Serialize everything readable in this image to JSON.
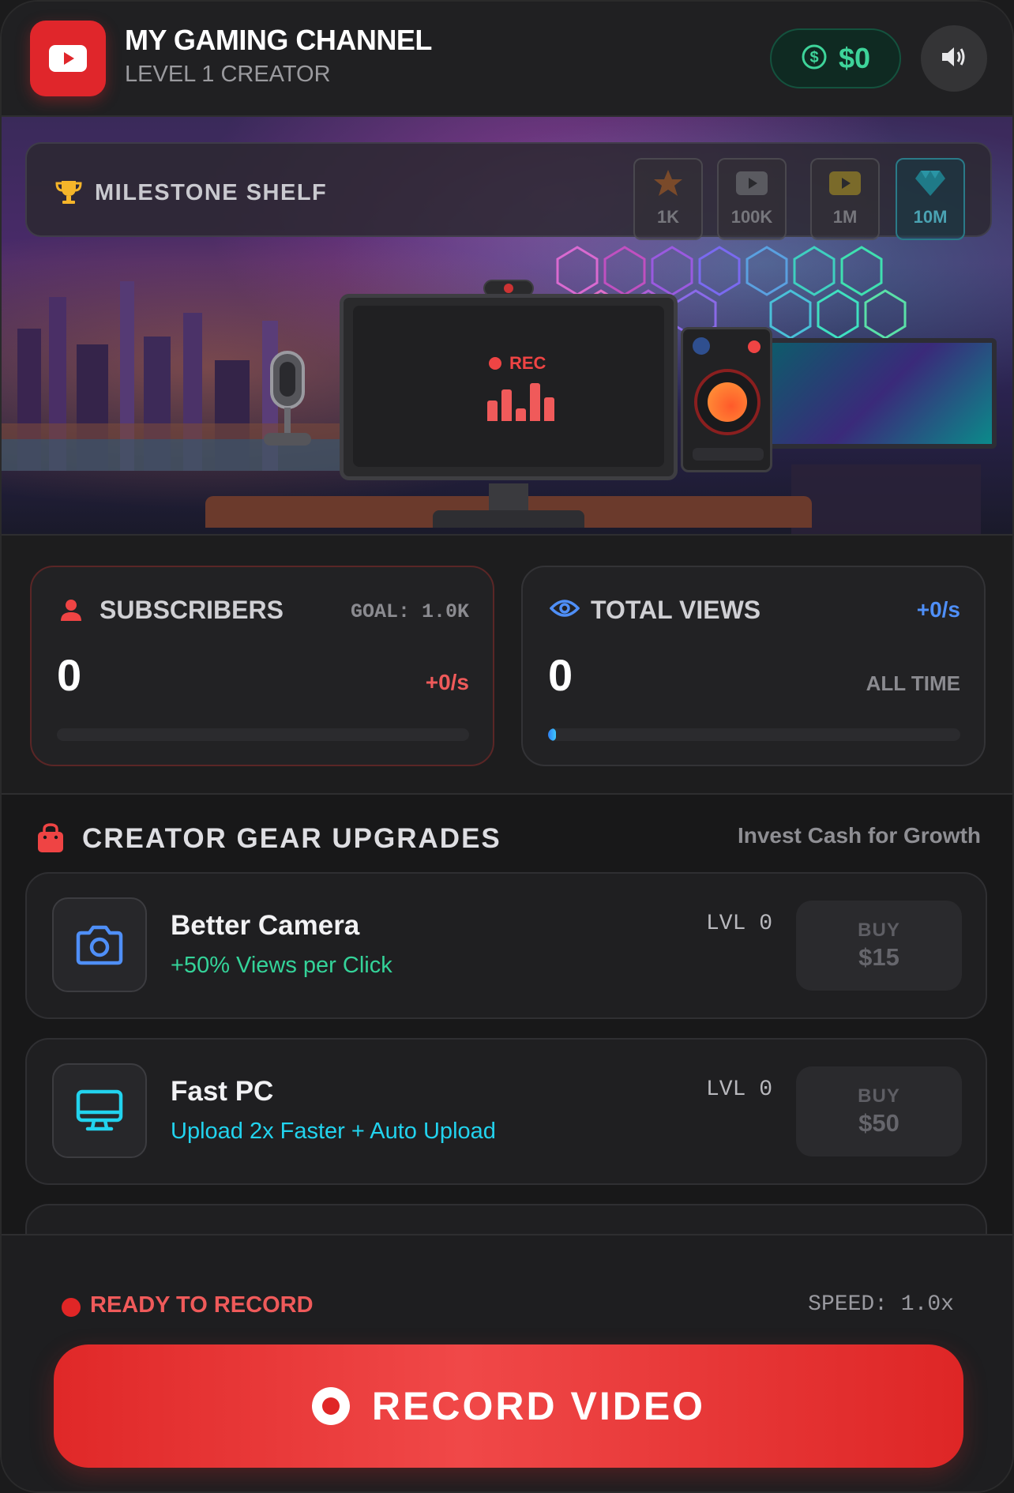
{
  "header": {
    "channel_title": "MY GAMING CHANNEL",
    "level": "LEVEL 1 CREATOR",
    "cash": "$0"
  },
  "milestones": {
    "title": "MILESTONE SHELF",
    "badges": [
      {
        "label": "1K",
        "icon": "star-icon"
      },
      {
        "label": "100K",
        "icon": "play-plaque-silver-icon"
      },
      {
        "label": "1M",
        "icon": "play-plaque-gold-icon"
      },
      {
        "label": "10M",
        "icon": "diamond-icon"
      }
    ]
  },
  "studio": {
    "rec_label": "REC"
  },
  "stats": {
    "subscribers": {
      "title": "SUBSCRIBERS",
      "goal": "GOAL: 1.0K",
      "value": "0",
      "rate": "+0/s",
      "progress": 0
    },
    "views": {
      "title": "TOTAL VIEWS",
      "rate": "+0/s",
      "value": "0",
      "note": "ALL TIME",
      "progress": 0.02
    }
  },
  "upgrades": {
    "title": "CREATOR GEAR UPGRADES",
    "subtitle": "Invest Cash for Growth",
    "items": [
      {
        "name": "Better Camera",
        "desc": "+50% Views per Click",
        "level": "LVL 0",
        "buy_label": "BUY",
        "price": "$15",
        "icon": "camera-icon",
        "accent": "#34d399"
      },
      {
        "name": "Fast PC",
        "desc": "Upload 2x Faster + Auto Upload",
        "level": "LVL 0",
        "buy_label": "BUY",
        "price": "$50",
        "icon": "monitor-icon",
        "accent": "#22d3ee"
      }
    ]
  },
  "footer": {
    "status": "READY TO RECORD",
    "speed": "SPEED: 1.0x",
    "record_label": "RECORD VIDEO"
  },
  "colors": {
    "brand_red": "#e0262b",
    "cash_green": "#3ed49a",
    "views_blue": "#4f8ff7"
  }
}
